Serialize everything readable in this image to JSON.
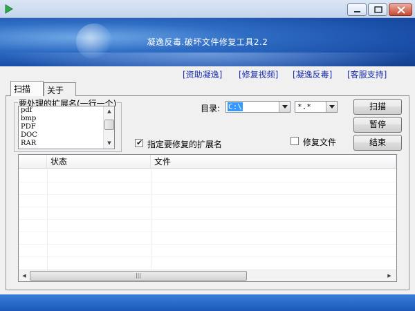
{
  "banner": {
    "title": "凝逸反毒.破坏文件修复工具2.2"
  },
  "links": [
    {
      "label": "[资助凝逸]"
    },
    {
      "label": "[修复视频]"
    },
    {
      "label": "[凝逸反毒]"
    },
    {
      "label": "[客服支持]"
    }
  ],
  "tabs": [
    {
      "label": "扫描"
    },
    {
      "label": "关于"
    }
  ],
  "extensions": {
    "legend": "要处理的扩展名(一行一个)",
    "items": [
      "pdf",
      "bmp",
      "PDF",
      "DOC",
      "RAR"
    ]
  },
  "directory": {
    "label": "目录:",
    "value": "C:\\",
    "pattern": "*.*"
  },
  "buttons": {
    "scan": "扫描",
    "pause": "暂停",
    "end": "结束"
  },
  "options": {
    "specify_ext_label": "指定要修复的扩展名",
    "specify_ext_checked": true,
    "repair_file_label": "修复文件",
    "repair_file_checked": false
  },
  "table": {
    "columns": [
      "",
      "状态",
      "文件"
    ],
    "rows": []
  },
  "colors": {
    "banner": "#2f6dc4",
    "link": "#1a2fb0",
    "selection": "#3399ff"
  }
}
